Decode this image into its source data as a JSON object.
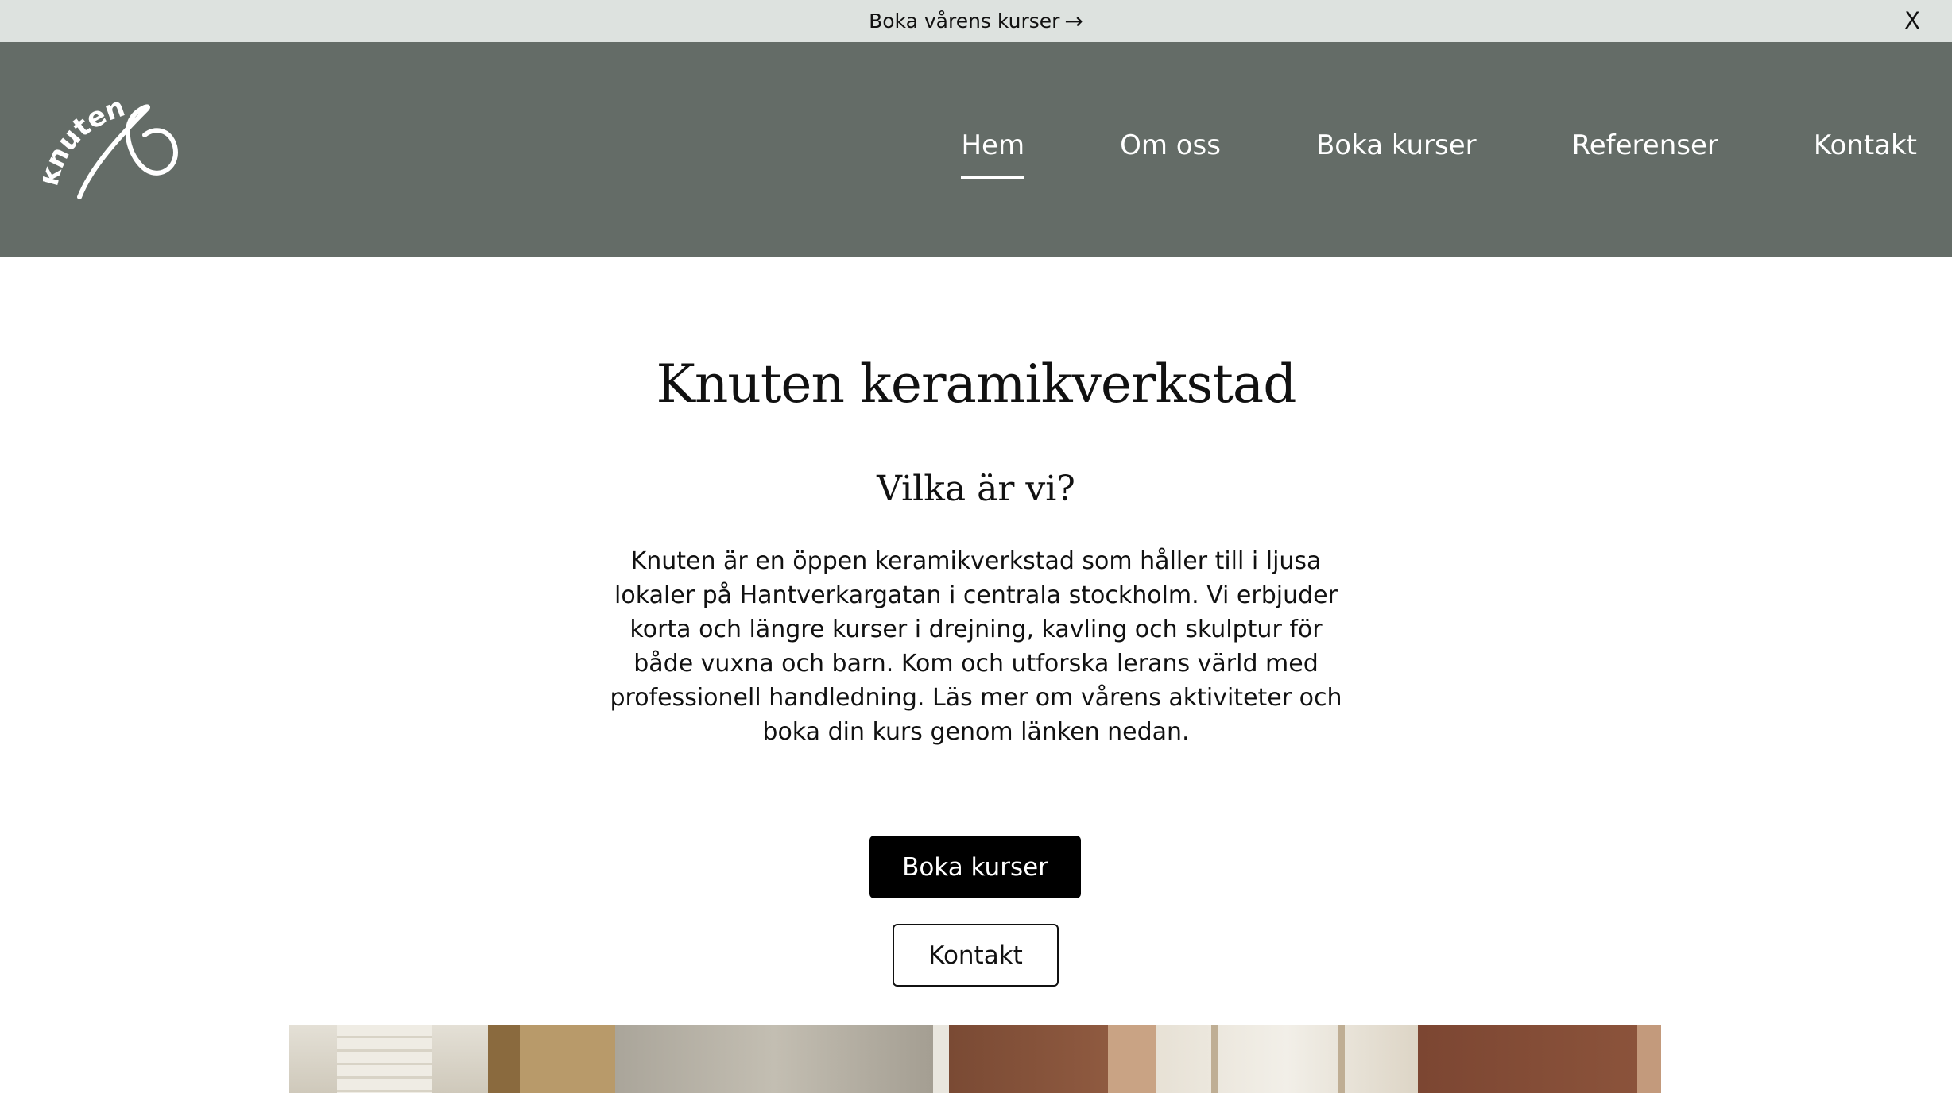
{
  "announcement": {
    "text": "Boka vårens kurser",
    "arrow": "→",
    "close_label": "X"
  },
  "header": {
    "logo_text": "knuten",
    "nav": [
      {
        "label": "Hem",
        "active": true
      },
      {
        "label": "Om oss",
        "active": false
      },
      {
        "label": "Boka kurser",
        "active": false
      },
      {
        "label": "Referenser",
        "active": false
      },
      {
        "label": "Kontakt",
        "active": false
      }
    ]
  },
  "hero": {
    "title": "Knuten keramikverkstad",
    "subtitle": "Vilka är vi?",
    "body": "Knuten är en öppen keramikverkstad som håller till i ljusa lokaler på Hantverkargatan i centrala stockholm. Vi erbjuder korta och längre kurser i drejning, kavling och skulptur för både vuxna och barn. Kom och utforska lerans värld med professionell handledning. Läs mer om vårens aktiviteter och boka din kurs genom länken nedan.",
    "primary_button": "Boka kurser",
    "secondary_button": "Kontakt"
  },
  "colors": {
    "announcement_bg": "#dde2df",
    "header_bg": "#646c67",
    "primary_button_bg": "#000000"
  }
}
